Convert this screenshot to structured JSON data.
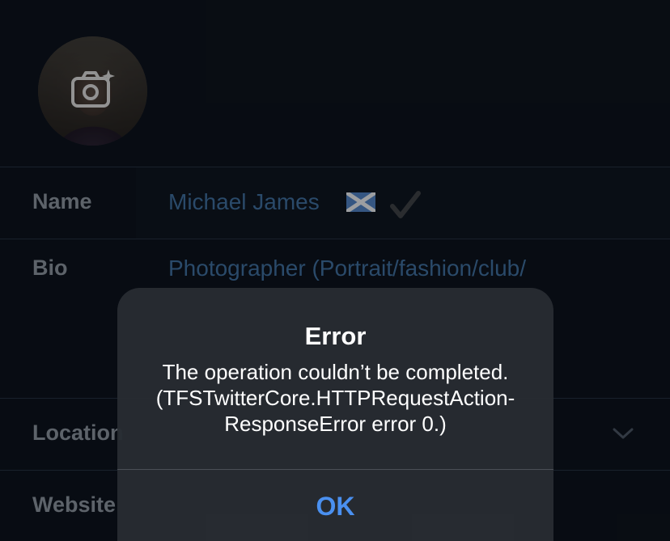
{
  "profile": {
    "name_label": "Name",
    "name_value": "Michael James",
    "bio_label": "Bio",
    "bio_value": "Photographer (Portrait/fashion/club/",
    "location_label": "Location",
    "website_label": "Website"
  },
  "alert": {
    "title": "Error",
    "message_line1": "The operation couldn’t be completed.",
    "message_line2": "(TFSTwitterCore.HTTPRequestAction-",
    "message_line3": "ResponseError error 0.)",
    "ok_label": "OK"
  },
  "icons": {
    "avatar_overlay": "camera-plus-icon",
    "name_flag": "scotland-flag-icon",
    "name_badge": "checkmark-icon",
    "location_chevron": "chevron-down-icon"
  },
  "colors": {
    "background": "#0d131c",
    "value_text": "#3f6d9c",
    "label_text": "#8a929c",
    "alert_button": "#4a90f0"
  }
}
